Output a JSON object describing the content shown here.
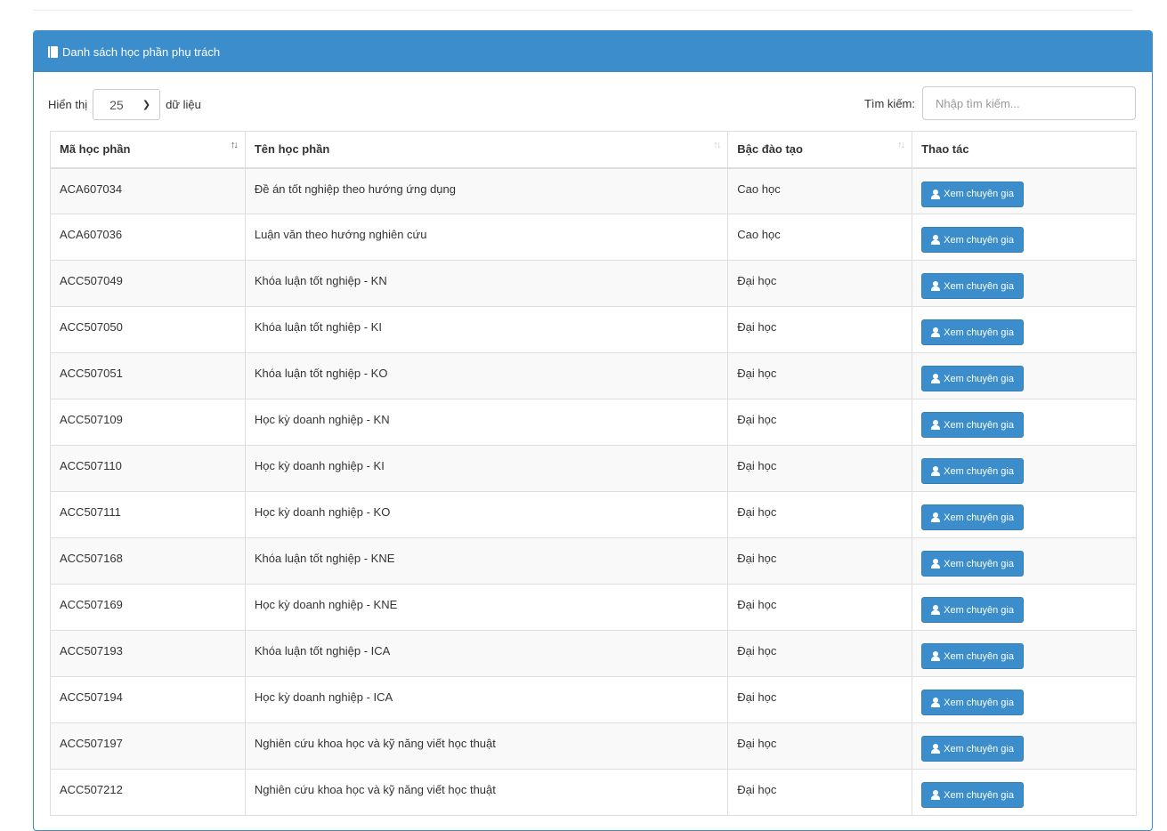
{
  "panel": {
    "title": "Danh sách học phần phụ trách",
    "title_icon": "book-icon"
  },
  "controls": {
    "show_label": "Hiển thị",
    "page_size": "25",
    "entries_label": "dữ liệu",
    "search_label": "Tìm kiếm:",
    "search_placeholder": "Nhập tìm kiếm..."
  },
  "table": {
    "columns": [
      "Mã học phần",
      "Tên học phần",
      "Bậc đào tạo",
      "Thao tác"
    ],
    "sort_glyph": "↑↓",
    "action_label": "Xem chuyên gia",
    "action_icon": "user-icon",
    "rows": [
      {
        "code": "ACA607034",
        "name": "Đề án tốt nghiệp theo hướng ứng dụng",
        "level": "Cao học"
      },
      {
        "code": "ACA607036",
        "name": "Luận văn theo hướng nghiên cứu",
        "level": "Cao học"
      },
      {
        "code": "ACC507049",
        "name": "Khóa luận tốt nghiệp - KN",
        "level": "Đại học"
      },
      {
        "code": "ACC507050",
        "name": "Khóa luận tốt nghiệp - KI",
        "level": "Đại học"
      },
      {
        "code": "ACC507051",
        "name": "Khóa luận tốt nghiệp - KO",
        "level": "Đại học"
      },
      {
        "code": "ACC507109",
        "name": "Học kỳ doanh nghiệp - KN",
        "level": "Đại học"
      },
      {
        "code": "ACC507110",
        "name": "Học kỳ doanh nghiệp - KI",
        "level": "Đại học"
      },
      {
        "code": "ACC507111",
        "name": "Học kỳ doanh nghiệp - KO",
        "level": "Đại học"
      },
      {
        "code": "ACC507168",
        "name": "Khóa luận tốt nghiệp - KNE",
        "level": "Đại học"
      },
      {
        "code": "ACC507169",
        "name": "Học kỳ doanh nghiệp - KNE",
        "level": "Đại học"
      },
      {
        "code": "ACC507193",
        "name": "Khóa luận tốt nghiệp - ICA",
        "level": "Đại học"
      },
      {
        "code": "ACC507194",
        "name": "Học kỳ doanh nghiệp - ICA",
        "level": "Đại học"
      },
      {
        "code": "ACC507197",
        "name": "Nghiên cứu khoa học và kỹ năng viết học thuật",
        "level": "Đại học"
      },
      {
        "code": "ACC507212",
        "name": "Nghiên cứu khoa học và kỹ năng viết học thuật",
        "level": "Đại học"
      }
    ]
  }
}
